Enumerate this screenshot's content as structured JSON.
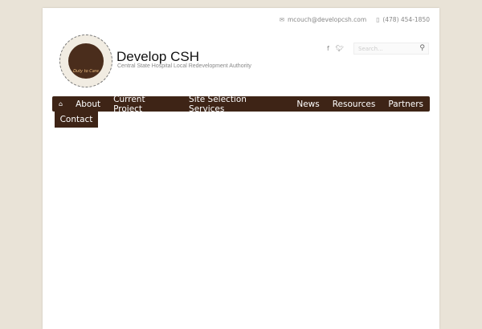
{
  "header": {
    "email": "mcouch@developcsh.com",
    "phone": "(478) 454-1850",
    "site_title": "Develop CSH",
    "tagline": "Central State Hospital Local Redevelopment Authority",
    "logo_text": "Central State Hospital · Duty to Care · Local Redevelopment Authority",
    "search_placeholder": "Search..."
  },
  "nav": {
    "items": [
      "About",
      "Current Project",
      "Site Selection Services",
      "News",
      "Resources",
      "Partners"
    ],
    "contact": "Contact"
  }
}
